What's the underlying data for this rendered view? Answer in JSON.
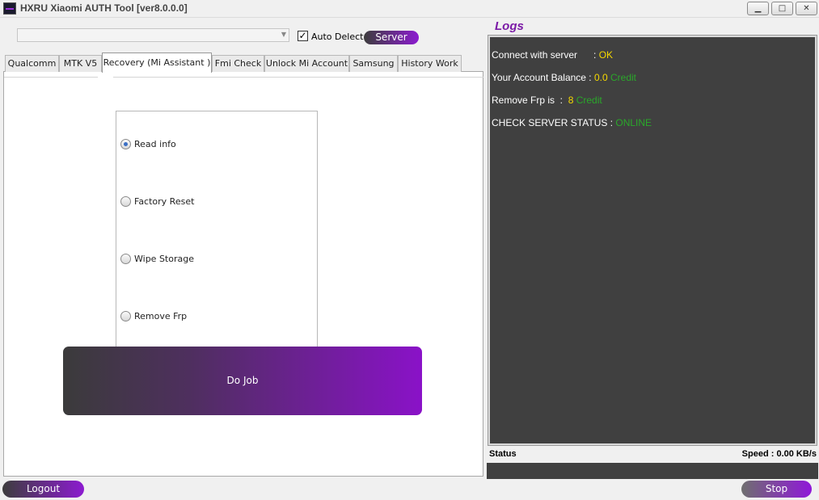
{
  "window": {
    "title": "HXRU Xiaomi AUTH  Tool [ver8.0.0.0]",
    "minimize_icon": "minimize-icon",
    "maximize_icon": "maximize-icon",
    "close_icon": "close-icon"
  },
  "toolbar": {
    "port_select_value": "",
    "auto_detect_label": "Auto Delect",
    "auto_detect_checked": true,
    "server_label": "Server"
  },
  "tabs": [
    {
      "label": "Qualcomm",
      "active": false
    },
    {
      "label": "MTK V5",
      "active": false
    },
    {
      "label": "Recovery (Mi Assistant )",
      "active": true
    },
    {
      "label": "Fmi Check",
      "active": false
    },
    {
      "label": "Unlock Mi Account",
      "active": false
    },
    {
      "label": "Samsung",
      "active": false
    },
    {
      "label": "History Work",
      "active": false
    }
  ],
  "options": [
    {
      "label": "Read info",
      "checked": true
    },
    {
      "label": "Factory Reset",
      "checked": false
    },
    {
      "label": "Wipe Storage",
      "checked": false
    },
    {
      "label": "Remove Frp",
      "checked": false
    }
  ],
  "do_job_label": "Do Job",
  "logs": {
    "title": "Logs",
    "lines": [
      {
        "label": "Connect with server      : ",
        "value": "OK",
        "value_color": "#f5d800",
        "unit": ""
      },
      {
        "label": "Your Account Balance : ",
        "value": "0.0",
        "value_color": "#f5d800",
        "unit": " Credit"
      },
      {
        "label": "Remove Frp is  :  ",
        "value": "8",
        "value_color": "#f5d800",
        "unit": " Credit"
      },
      {
        "label": "CHECK SERVER STATUS : ",
        "value": "ONLINE",
        "value_color": "#2aa82a",
        "unit": ""
      }
    ]
  },
  "status": {
    "label": "Status",
    "speed": "Speed : 0.00 KB/s"
  },
  "footer": {
    "logout_label": "Logout",
    "stop_label": "Stop"
  },
  "colors": {
    "accent": "#8c1bd0",
    "log_background": "#404040",
    "log_value": "#f5d800",
    "log_ok": "#2aa82a"
  }
}
